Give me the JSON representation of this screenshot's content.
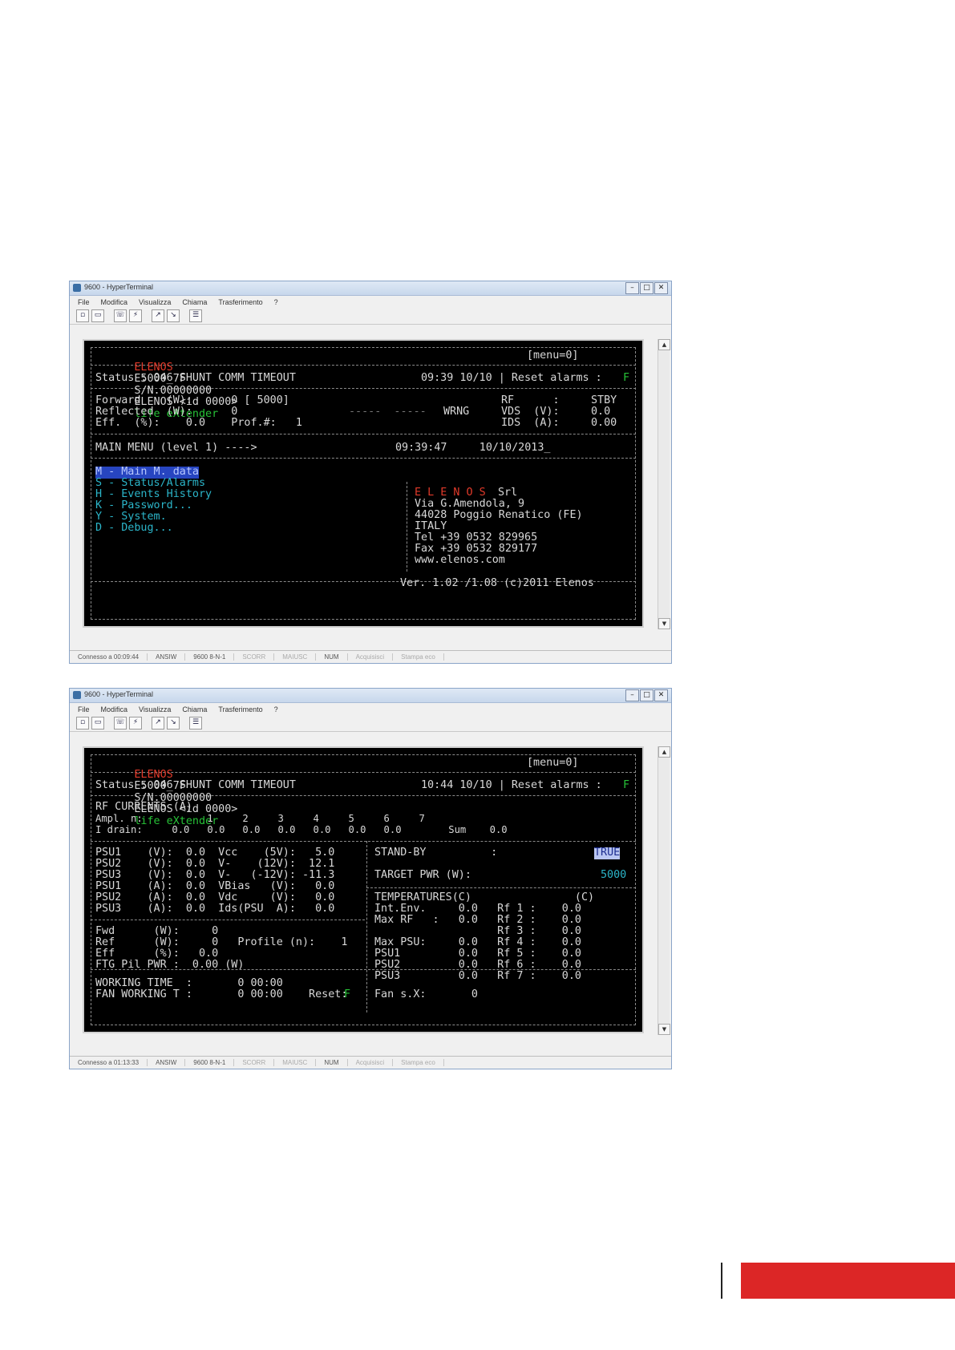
{
  "windows": [
    {
      "title": "9600 - HyperTerminal",
      "menu": [
        "File",
        "Modifica",
        "Visualizza",
        "Chiama",
        "Trasferimento",
        "?"
      ],
      "status": [
        "Connesso a 00:09:44",
        "ANSIW",
        "9600 8-N-1",
        "SCORR",
        "MAIUSC",
        "NUM",
        "Acquisisci",
        "Stampa eco"
      ],
      "terminal": {
        "brand": "ELENOS",
        "model": "E5000_7F",
        "serial": "S/N.00000000",
        "company_id": "ELENOS <id 0000>",
        "life": "life eXtender",
        "menu_level": "[menu=0]",
        "status_line": "Status : 046 SHUNT COMM TIMEOUT",
        "time_status": "09:39 10/10 | Reset alarms :",
        "reset_flag": "F",
        "meter_lines": [
          "Forward    (W):      0 [ 5000]",
          "Reflected  (W):      0",
          "Eff.  (%):    0.0    Prof.#:   1"
        ],
        "mid_labels": [
          "-----  -----",
          "WRNG"
        ],
        "rf_col": [
          "RF      :",
          "VDS  (V):",
          "IDS  (A):"
        ],
        "stby_col": [
          "STBY",
          "0.0",
          "0.00"
        ],
        "main_menu": "MAIN MENU (level 1) ---->",
        "clock": "09:39:47     10/10/2013_",
        "menu_items": [
          "M - Main M. data",
          "S - Status/Alarms",
          "H - Events History",
          "K - Password...",
          "Y - System.",
          "D - Debug..."
        ],
        "address": {
          "logo": "E L E N O S",
          "srl": "Srl",
          "lines": [
            "Via G.Amendola, 9",
            "44028 Poggio Renatico (FE)",
            "ITALY",
            "Tel +39 0532 829965",
            "Fax +39 0532 829177",
            "www.elenos.com"
          ]
        },
        "version": "Ver. 1.02 /1.08 (c)2011 Elenos"
      }
    },
    {
      "title": "9600 - HyperTerminal",
      "menu": [
        "File",
        "Modifica",
        "Visualizza",
        "Chiama",
        "Trasferimento",
        "?"
      ],
      "status": [
        "Connesso a 01:13:33",
        "ANSIW",
        "9600 8-N-1",
        "SCORR",
        "MAIUSC",
        "NUM",
        "Acquisisci",
        "Stampa eco"
      ],
      "terminal": {
        "brand": "ELENOS",
        "model": "E5000_7F",
        "serial": "S/N.00000000",
        "company_id": "ELENOS <id 0000>",
        "life": "life eXtender",
        "menu_level": "[menu=0]",
        "status_line": "Status : 046 SHUNT COMM TIMEOUT",
        "time_status": "10:44 10/10 | Reset alarms :",
        "reset_flag": "F",
        "rf_currents_lines": [
          "RF CURRENTS (A)",
          "Ampl. n:           1     2     3     4     5     6     7",
          "I drain:     0.0   0.0   0.0   0.0   0.0   0.0   0.0        Sum    0.0"
        ],
        "psu_lines": [
          "PSU1    (V):  0.0  Vcc    (5V):   5.0",
          "PSU2    (V):  0.0  V-    (12V):  12.1",
          "PSU3    (V):  0.0  V-   (-12V): -11.3",
          "PSU1    (A):  0.0  VBias   (V):   0.0",
          "PSU2    (A):  0.0  Vdc     (V):   0.0",
          "PSU3    (A):  0.0  Ids(PSU  A):   0.0"
        ],
        "fwd_lines": [
          "Fwd      (W):     0",
          "Ref      (W):     0   Profile (n):    1",
          "Eff      (%):   0.0",
          "FTG Pil PWR :  0.00 (W)"
        ],
        "working_lines": [
          "WORKING TIME  :       0 00:00",
          "FAN WORKING T :       0 00:00    Reset:"
        ],
        "standby_label": "STAND-BY          :",
        "standby_value": "TRUE",
        "target_label": "TARGET PWR (W):",
        "target_value": "5000",
        "temp_lines": [
          "TEMPERATURES(C)                (C)",
          "Int.Env.     0.0   Rf 1 :    0.0",
          "Max RF   :   0.0   Rf 2 :    0.0",
          "                   Rf 3 :    0.0",
          "Max PSU:     0.0   Rf 4 :    0.0",
          "PSU1         0.0   Rf 5 :    0.0",
          "PSU2         0.0   Rf 6 :    0.0",
          "PSU3         0.0   Rf 7 :    0.0"
        ],
        "fan_line": "Fan s.X:       0"
      }
    }
  ]
}
